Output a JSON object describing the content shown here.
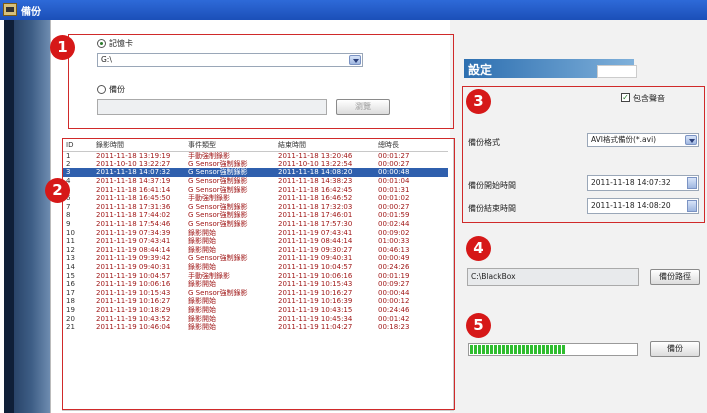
{
  "window": {
    "title": "備份"
  },
  "source": {
    "radio_card_label": "記憶卡",
    "card_path": "G:\\",
    "radio_backup_label": "備份",
    "backup_path": "",
    "browse_label": "瀏覽"
  },
  "table": {
    "columns": [
      "ID",
      "錄影時間",
      "事件類型",
      "結束時間",
      "總時長"
    ],
    "rows": [
      [
        "1",
        "2011-11-18 13:19:19",
        "手動強制錄影",
        "2011-11-18 13:20:46",
        "00:01:27"
      ],
      [
        "2",
        "2011-10-10 13:22:27",
        "G Sensor強制錄影",
        "2011-10-10 13:22:54",
        "00:00:27"
      ],
      [
        "3",
        "2011-11-18 14:07:32",
        "G Sensor強制錄影",
        "2011-11-18 14:08:20",
        "00:00:48"
      ],
      [
        "4",
        "2011-11-18 14:37:19",
        "G Sensor強制錄影",
        "2011-11-18 14:38:23",
        "00:01:04"
      ],
      [
        "5",
        "2011-11-18 16:41:14",
        "G Sensor強制錄影",
        "2011-11-18 16:42:45",
        "00:01:31"
      ],
      [
        "6",
        "2011-11-18 16:45:50",
        "手動強制錄影",
        "2011-11-18 16:46:52",
        "00:01:02"
      ],
      [
        "7",
        "2011-11-18 17:31:36",
        "G Sensor強制錄影",
        "2011-11-18 17:32:03",
        "00:00:27"
      ],
      [
        "8",
        "2011-11-18 17:44:02",
        "G Sensor強制錄影",
        "2011-11-18 17:46:01",
        "00:01:59"
      ],
      [
        "9",
        "2011-11-18 17:54:46",
        "G Sensor強制錄影",
        "2011-11-18 17:57:30",
        "00:02:44"
      ],
      [
        "10",
        "2011-11-19 07:34:39",
        "錄影開始",
        "2011-11-19 07:43:41",
        "00:09:02"
      ],
      [
        "11",
        "2011-11-19 07:43:41",
        "錄影開始",
        "2011-11-19 08:44:14",
        "01:00:33"
      ],
      [
        "12",
        "2011-11-19 08:44:14",
        "錄影開始",
        "2011-11-19 09:30:27",
        "00:46:13"
      ],
      [
        "13",
        "2011-11-19 09:39:42",
        "G Sensor強制錄影",
        "2011-11-19 09:40:31",
        "00:00:49"
      ],
      [
        "14",
        "2011-11-19 09:40:31",
        "錄影開始",
        "2011-11-19 10:04:57",
        "00:24:26"
      ],
      [
        "15",
        "2011-11-19 10:04:57",
        "手動強制錄影",
        "2011-11-19 10:06:16",
        "00:01:19"
      ],
      [
        "16",
        "2011-11-19 10:06:16",
        "錄影開始",
        "2011-11-19 10:15:43",
        "00:09:27"
      ],
      [
        "17",
        "2011-11-19 10:15:43",
        "G Sensor強制錄影",
        "2011-11-19 10:16:27",
        "00:00:44"
      ],
      [
        "18",
        "2011-11-19 10:16:27",
        "錄影開始",
        "2011-11-19 10:16:39",
        "00:00:12"
      ],
      [
        "19",
        "2011-11-19 10:18:29",
        "錄影開始",
        "2011-11-19 10:43:15",
        "00:24:46"
      ],
      [
        "20",
        "2011-11-19 10:43:52",
        "錄影開始",
        "2011-11-19 10:45:34",
        "00:01:42"
      ],
      [
        "21",
        "2011-11-19 10:46:04",
        "錄影開始",
        "2011-11-19 11:04:27",
        "00:18:23"
      ]
    ],
    "selected_row": 2
  },
  "settings": {
    "title": "設定",
    "include_audio_label": "包含聲音",
    "include_audio_checked": true,
    "format_label": "備份格式",
    "format_value": "AVI格式備份(*.avi)",
    "start_label": "備份開始時間",
    "start_value": "2011-11-18 14:07:32",
    "end_label": "備份結束時間",
    "end_value": "2011-11-18 14:08:20"
  },
  "output": {
    "path_value": "C:\\BlackBox",
    "path_button": "備份路徑"
  },
  "progress": {
    "fraction": 0.58,
    "backup_button": "備份"
  },
  "badges": {
    "b1": "1",
    "b2": "2",
    "b3": "3",
    "b4": "4",
    "b5": "5"
  },
  "colors": {
    "annotation_red": "#d02a2a",
    "badge_red": "#d61818",
    "selection_blue": "#2f5fad",
    "progress_green": "#2fbd2f"
  }
}
